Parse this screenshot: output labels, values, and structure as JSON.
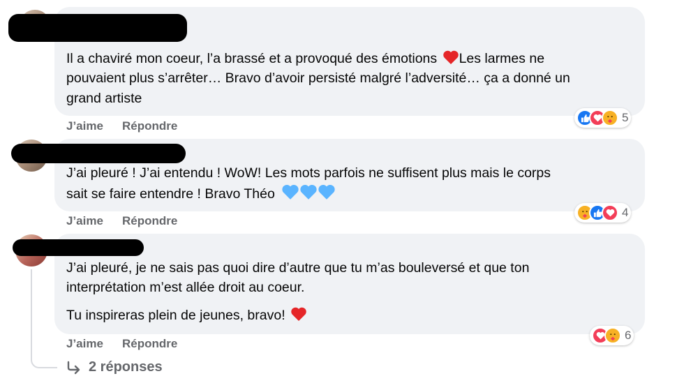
{
  "comments": [
    {
      "author": "",
      "lines": [
        "Il a chaviré mon coeur, l’a brassé et a provoqué des émotions",
        "pouvaient plus s’arrêter… Bravo d’avoir persisté malgré l’adversité… ça a donné un",
        "grand artiste"
      ],
      "line1_after": "Les larmes ne",
      "actions": {
        "like": "J’aime",
        "reply": "Répondre"
      },
      "reactions": [
        "like",
        "love",
        "care"
      ],
      "reaction_count": "5"
    },
    {
      "author": "",
      "lines": [
        "J’ai pleuré ! J’ai entendu ! WoW! Les mots parfois ne suffisent plus mais le corps",
        "sait se faire entendre ! Bravo Théo"
      ],
      "actions": {
        "like": "J’aime",
        "reply": "Répondre"
      },
      "reactions": [
        "care",
        "like",
        "love"
      ],
      "reaction_count": "4"
    },
    {
      "author": "",
      "lines": [
        "J’ai pleuré, je ne sais pas quoi dire d’autre que tu m’as bouleversé et que ton",
        "interprétation m’est allée droit au coeur.",
        "Tu inspireras plein de jeunes, bravo!"
      ],
      "actions": {
        "like": "J’aime",
        "reply": "Répondre"
      },
      "reactions": [
        "love",
        "care"
      ],
      "reaction_count": "6"
    }
  ],
  "replies_link": "2 réponses",
  "colors": {
    "bubble": "#f0f2f5",
    "meta_text": "#65676b",
    "like": "#1877f2",
    "love": "#f33e58",
    "care": "#f7b125",
    "blue_heart": "#5ab4ff"
  }
}
